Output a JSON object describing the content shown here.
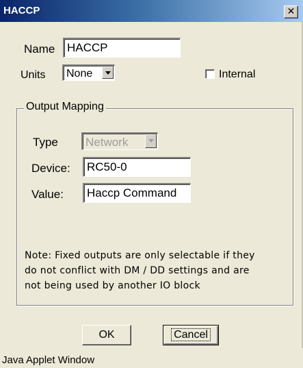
{
  "window": {
    "title": "HACCP",
    "close_glyph": "✕",
    "close_icon": "close-icon"
  },
  "form": {
    "name_label": "Name",
    "name_value": "HACCP",
    "units_label": "Units",
    "units_value": "None",
    "internal_label": "Internal",
    "internal_checked": false
  },
  "output_mapping": {
    "title": "Output Mapping",
    "type_label": "Type",
    "type_value": "Network",
    "type_enabled": false,
    "device_label": "Device:",
    "device_value": "RC50-0",
    "value_label": "Value:",
    "value_value": "Haccp Command"
  },
  "note": {
    "line1": "Note: Fixed outputs are only selectable if they",
    "line2": "do not conflict with DM / DD settings and are",
    "line3": "not being used by another IO block"
  },
  "buttons": {
    "ok_label": "OK",
    "cancel_label": "Cancel"
  },
  "status": {
    "text": "Java Applet Window"
  },
  "colors": {
    "titlebar_start": "#0a246a",
    "titlebar_end": "#a6caf0",
    "dialog_bg": "#ece9d8",
    "disabled_text": "#9d9d9d"
  }
}
